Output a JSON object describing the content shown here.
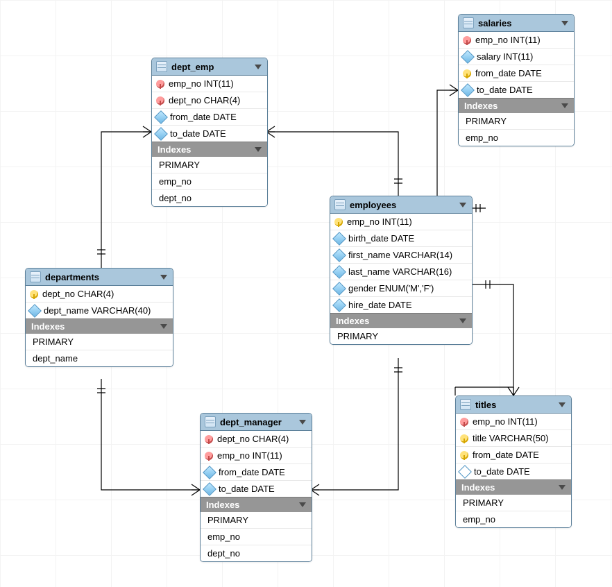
{
  "section_indexes_label": "Indexes",
  "tables": {
    "dept_emp": {
      "title": "dept_emp",
      "columns": [
        {
          "icon": "key-r",
          "text": "emp_no INT(11)"
        },
        {
          "icon": "key-r",
          "text": "dept_no CHAR(4)"
        },
        {
          "icon": "col",
          "text": "from_date DATE"
        },
        {
          "icon": "col",
          "text": "to_date DATE"
        }
      ],
      "indexes": [
        "PRIMARY",
        "emp_no",
        "dept_no"
      ]
    },
    "salaries": {
      "title": "salaries",
      "columns": [
        {
          "icon": "key-r",
          "text": "emp_no INT(11)"
        },
        {
          "icon": "col",
          "text": "salary INT(11)"
        },
        {
          "icon": "key-y",
          "text": "from_date DATE"
        },
        {
          "icon": "col",
          "text": "to_date DATE"
        }
      ],
      "indexes": [
        "PRIMARY",
        "emp_no"
      ]
    },
    "departments": {
      "title": "departments",
      "columns": [
        {
          "icon": "key-y",
          "text": "dept_no CHAR(4)"
        },
        {
          "icon": "col",
          "text": "dept_name VARCHAR(40)"
        }
      ],
      "indexes": [
        "PRIMARY",
        "dept_name"
      ]
    },
    "employees": {
      "title": "employees",
      "columns": [
        {
          "icon": "key-y",
          "text": "emp_no INT(11)"
        },
        {
          "icon": "col",
          "text": "birth_date DATE"
        },
        {
          "icon": "col",
          "text": "first_name VARCHAR(14)"
        },
        {
          "icon": "col",
          "text": "last_name VARCHAR(16)"
        },
        {
          "icon": "col",
          "text": "gender ENUM('M','F')"
        },
        {
          "icon": "col",
          "text": "hire_date DATE"
        }
      ],
      "indexes": [
        "PRIMARY"
      ]
    },
    "dept_manager": {
      "title": "dept_manager",
      "columns": [
        {
          "icon": "key-r",
          "text": "dept_no CHAR(4)"
        },
        {
          "icon": "key-r",
          "text": "emp_no INT(11)"
        },
        {
          "icon": "col",
          "text": "from_date DATE"
        },
        {
          "icon": "col",
          "text": "to_date DATE"
        }
      ],
      "indexes": [
        "PRIMARY",
        "emp_no",
        "dept_no"
      ]
    },
    "titles": {
      "title": "titles",
      "columns": [
        {
          "icon": "key-r",
          "text": "emp_no INT(11)"
        },
        {
          "icon": "key-y",
          "text": "title VARCHAR(50)"
        },
        {
          "icon": "key-y",
          "text": "from_date DATE"
        },
        {
          "icon": "col hollow",
          "text": "to_date DATE"
        }
      ],
      "indexes": [
        "PRIMARY",
        "emp_no"
      ]
    }
  },
  "relationships": [
    {
      "from": "dept_emp",
      "to": "departments",
      "type": "many-to-one"
    },
    {
      "from": "dept_emp",
      "to": "employees",
      "type": "many-to-one"
    },
    {
      "from": "dept_manager",
      "to": "departments",
      "type": "many-to-one"
    },
    {
      "from": "dept_manager",
      "to": "employees",
      "type": "many-to-one"
    },
    {
      "from": "salaries",
      "to": "employees",
      "type": "many-to-one"
    },
    {
      "from": "titles",
      "to": "employees",
      "type": "many-to-one"
    }
  ]
}
